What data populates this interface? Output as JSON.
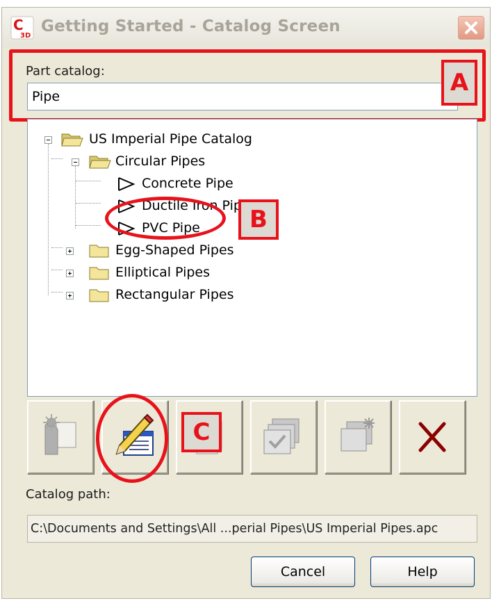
{
  "window": {
    "title": "Getting Started - Catalog Screen",
    "app_icon_label": "C3D"
  },
  "part_catalog": {
    "label": "Part catalog:",
    "value": "Pipe"
  },
  "tree": {
    "root": "US Imperial Pipe Catalog",
    "circular": "Circular Pipes",
    "concrete": "Concrete Pipe",
    "ductile": "Ductile Iron Pip",
    "pvc": "PVC Pipe",
    "egg": "Egg-Shaped Pipes",
    "elliptical": "Elliptical Pipes",
    "rectangular": "Rectangular Pipes"
  },
  "annotations": {
    "a": "A",
    "b": "B",
    "c": "C"
  },
  "toolbar": {
    "icons": [
      "new-part-icon",
      "edit-part-icon",
      "copy-icon",
      "check-icon",
      "regenerate-icon",
      "delete-icon"
    ]
  },
  "catalog_path": {
    "label": "Catalog path:",
    "value": "C:\\Documents and Settings\\All ...perial Pipes\\US Imperial Pipes.apc"
  },
  "buttons": {
    "cancel": "Cancel",
    "help": "Help"
  },
  "colors": {
    "annotation": "#e8121b",
    "dialog_bg": "#ece9d8",
    "delete_x": "#8b0000"
  }
}
